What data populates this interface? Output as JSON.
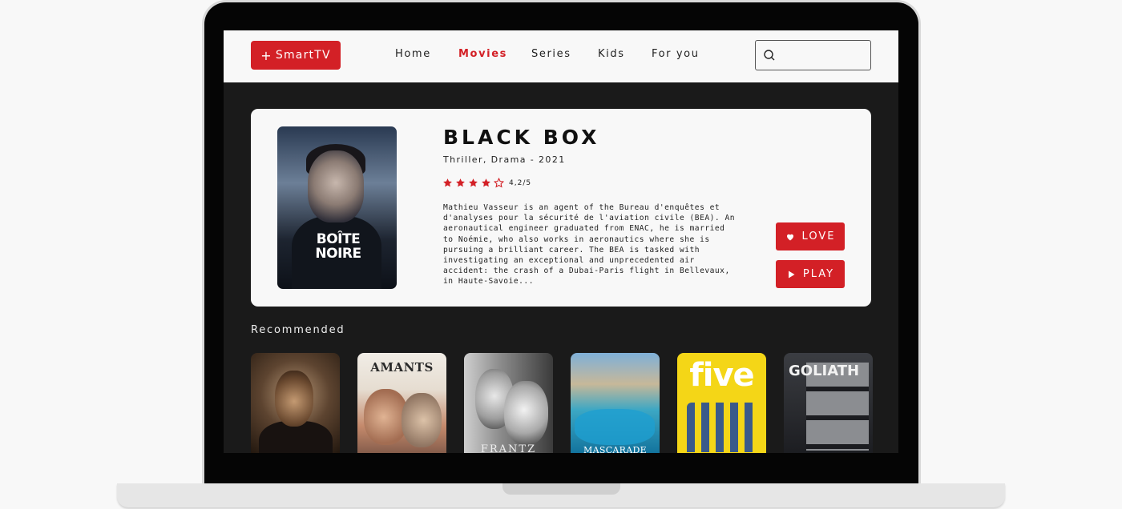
{
  "nav": {
    "logo_plus": "+",
    "logo_text": "SmartTV",
    "items": [
      "Home",
      "Movies",
      "Series",
      "Kids",
      "For you"
    ],
    "active": "Movies",
    "search_placeholder": ""
  },
  "featured": {
    "title": "BLACK BOX",
    "meta": "Thriller, Drama - 2021",
    "rating": "4,2/5",
    "stars_filled": 4,
    "stars_total": 5,
    "synopsis": "Mathieu Vasseur is an agent of the Bureau d'enquêtes et d'analyses pour la sécurité de l'aviation civile (BEA). An aeronautical engineer graduated from ENAC, he is married to Noémie, who also works in aeronautics where she is pursuing a brilliant career. The BEA is tasked with investigating an exceptional and unprecedented air accident: the crash of a Dubai-Paris flight in Bellevaux, in Haute-Savoie...",
    "poster_title": "BOÎTE NOIRE",
    "love_label": "LOVE",
    "play_label": "PLAY"
  },
  "recommended": {
    "title": "Recommended",
    "posters": [
      "",
      "AMANTS",
      "FRANTZ",
      "MASCARADE",
      "five",
      "GOLIATH"
    ]
  },
  "colors": {
    "accent": "#d32026",
    "screen_bg": "#1a1a1a",
    "card_bg": "#f8f8f8"
  }
}
